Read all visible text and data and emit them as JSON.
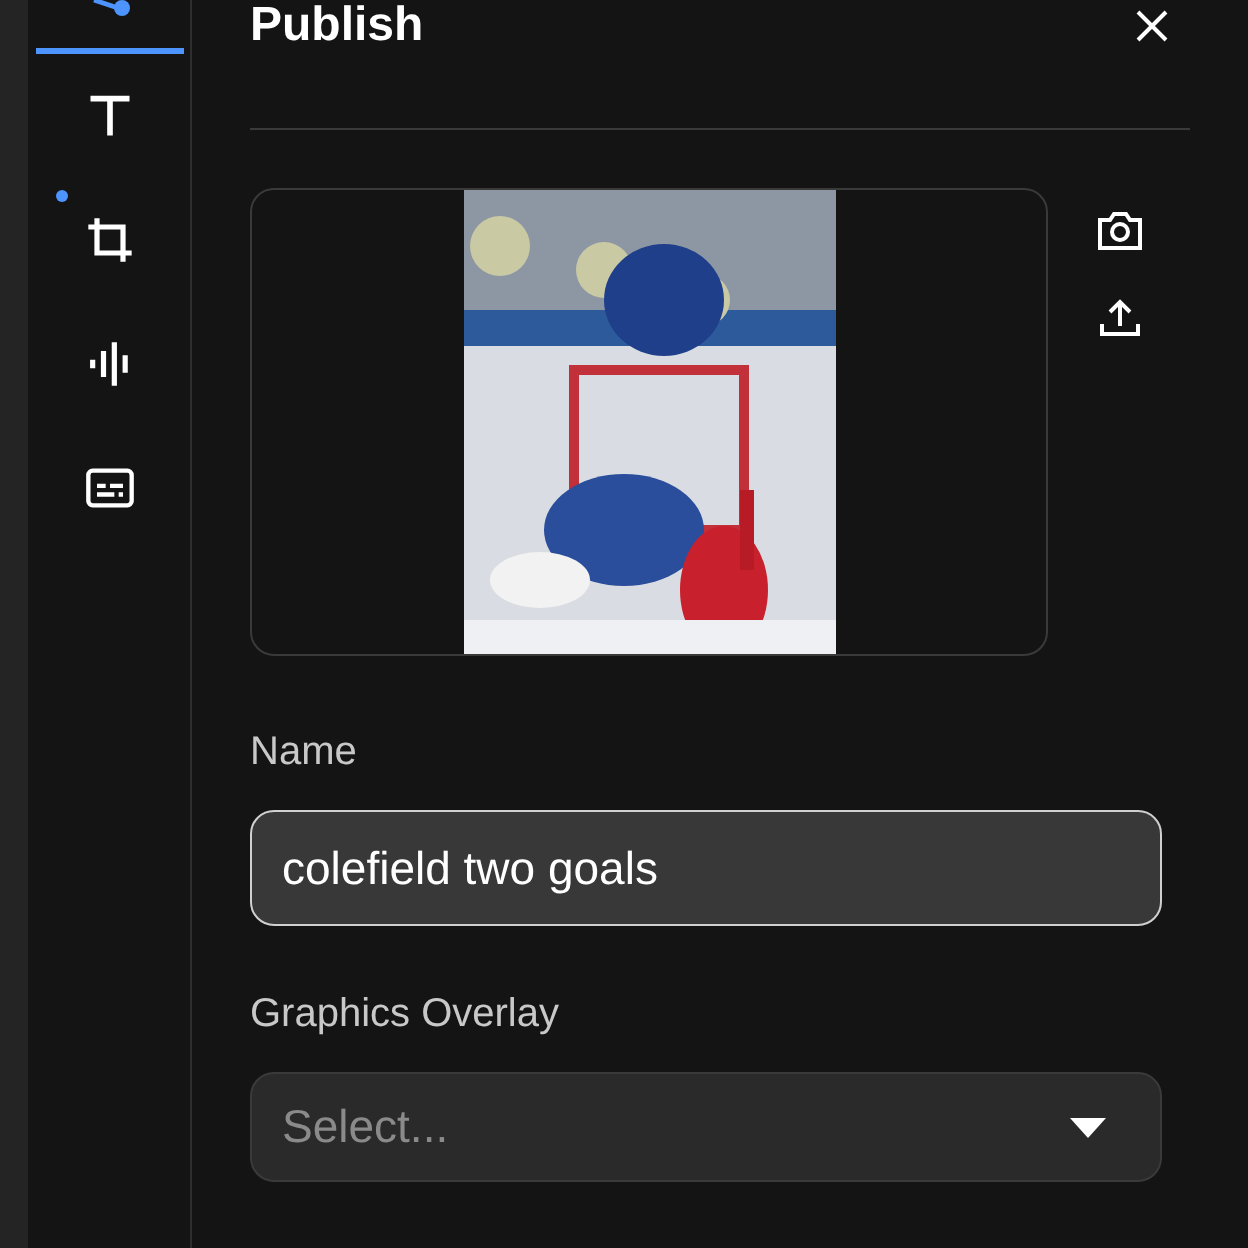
{
  "sidebar": {
    "tools": [
      {
        "kind": "nodes",
        "selected": true,
        "dot": false
      },
      {
        "kind": "text",
        "selected": false,
        "dot": false
      },
      {
        "kind": "crop",
        "selected": false,
        "dot": true
      },
      {
        "kind": "audio",
        "selected": false,
        "dot": false
      },
      {
        "kind": "captions",
        "selected": false,
        "dot": false
      }
    ]
  },
  "panel": {
    "title": "Publish",
    "fields": [
      {
        "kind": "text",
        "label": "Name",
        "value": "colefield two goals",
        "focused": true
      },
      {
        "kind": "select",
        "label": "Graphics Overlay",
        "placeholder": "Select..."
      }
    ]
  }
}
